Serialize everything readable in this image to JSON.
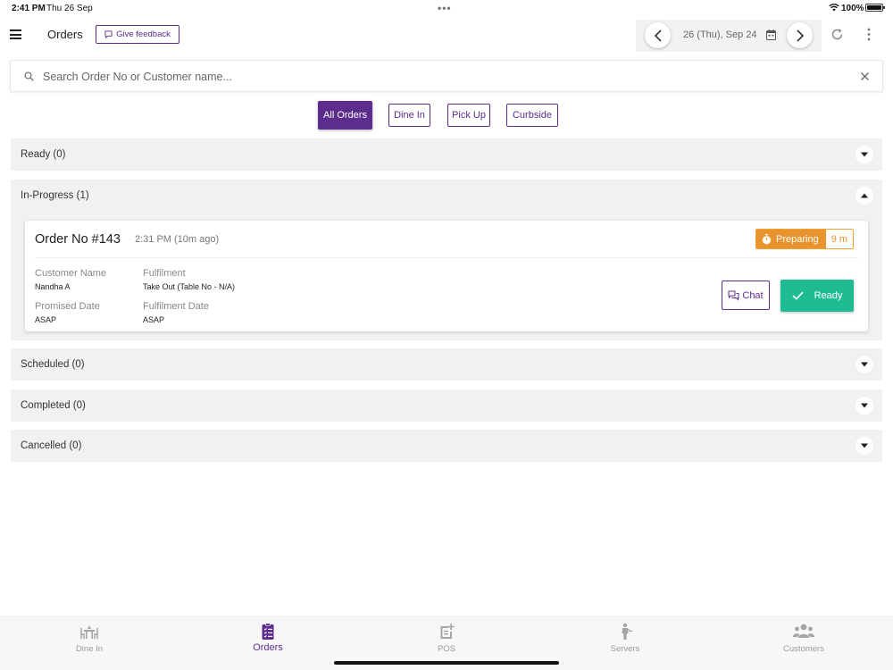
{
  "status_bar": {
    "time": "2:41 PM",
    "date": "Thu 26 Sep",
    "battery": "100%"
  },
  "header": {
    "title": "Orders",
    "feedback_label": "Give feedback",
    "date_label": "26 (Thu), Sep 24"
  },
  "search": {
    "placeholder": "Search Order No or Customer name..."
  },
  "filters": [
    {
      "label": "All Orders",
      "active": true
    },
    {
      "label": "Dine In",
      "active": false
    },
    {
      "label": "Pick Up",
      "active": false
    },
    {
      "label": "Curbside",
      "active": false
    }
  ],
  "sections": {
    "ready": {
      "title": "Ready (0)",
      "expanded": false
    },
    "in_progress": {
      "title": "In-Progress (1)",
      "expanded": true
    },
    "scheduled": {
      "title": "Scheduled (0)",
      "expanded": false
    },
    "completed": {
      "title": "Completed (0)",
      "expanded": false
    },
    "cancelled": {
      "title": "Cancelled (0)",
      "expanded": false
    }
  },
  "order": {
    "number": "Order No #143",
    "time": "2:31 PM (10m ago)",
    "status": "Preparing",
    "elapsed": "9 m",
    "customer_label": "Customer Name",
    "customer_value": "Nandha A",
    "fulfilment_label": "Fulfilment",
    "fulfilment_value": "Take Out (Table No - N/A)",
    "promised_label": "Promised Date",
    "promised_value": "ASAP",
    "fulfilment_date_label": "Fulfilment Date",
    "fulfilment_date_value": "ASAP",
    "chat_label": "Chat",
    "ready_label": "Ready"
  },
  "tabs": [
    {
      "label": "Dine In",
      "icon": "table-chairs-icon",
      "active": false
    },
    {
      "label": "Orders",
      "icon": "clipboard-list-icon",
      "active": true
    },
    {
      "label": "POS",
      "icon": "receipt-add-icon",
      "active": false
    },
    {
      "label": "Servers",
      "icon": "waiter-icon",
      "active": false
    },
    {
      "label": "Customers",
      "icon": "users-icon",
      "active": false
    }
  ],
  "colors": {
    "brand_purple": "#5c2d8c",
    "preparing_orange": "#e8932e",
    "ready_green": "#1fbc94",
    "section_gray": "#f1f1f1"
  }
}
